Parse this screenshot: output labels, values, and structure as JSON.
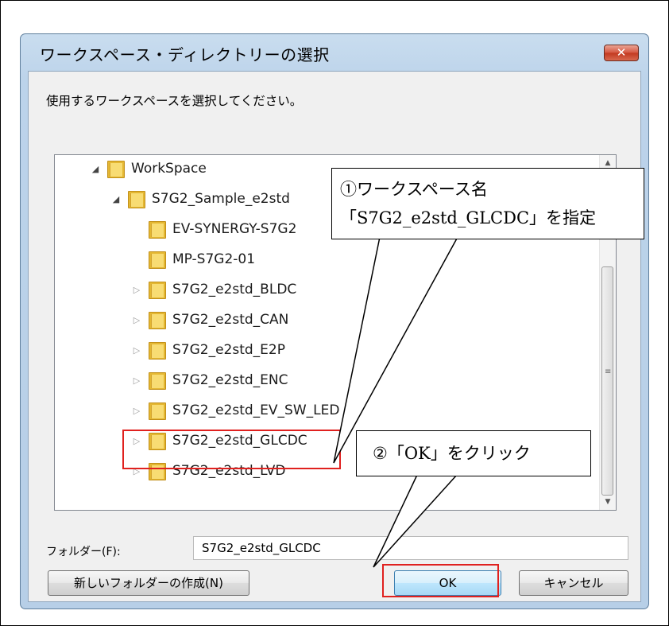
{
  "dialog": {
    "title": "ワークスペース・ディレクトリーの選択",
    "close_glyph": "✕",
    "instruction": "使用するワークスペースを選択してください。"
  },
  "tree": {
    "items": [
      {
        "label": "WorkSpace",
        "expander": "◢",
        "state": "expanded"
      },
      {
        "label": "S7G2_Sample_e2std",
        "expander": "◢",
        "state": "expanded"
      },
      {
        "label": "EV-SYNERGY-S7G2",
        "expander": "",
        "state": "leaf"
      },
      {
        "label": "MP-S7G2-01",
        "expander": "",
        "state": "leaf"
      },
      {
        "label": "S7G2_e2std_BLDC",
        "expander": "▷",
        "state": "collapsed"
      },
      {
        "label": "S7G2_e2std_CAN",
        "expander": "▷",
        "state": "collapsed"
      },
      {
        "label": "S7G2_e2std_E2P",
        "expander": "▷",
        "state": "collapsed"
      },
      {
        "label": "S7G2_e2std_ENC",
        "expander": "▷",
        "state": "collapsed"
      },
      {
        "label": "S7G2_e2std_EV_SW_LED",
        "expander": "▷",
        "state": "collapsed"
      },
      {
        "label": "S7G2_e2std_GLCDC",
        "expander": "▷",
        "state": "selected"
      },
      {
        "label": "S7G2_e2std_LVD",
        "expander": "▷",
        "state": "collapsed"
      }
    ],
    "scroll_up_glyph": "▲",
    "scroll_down_glyph": "▼",
    "scroll_grip_glyph": "≡"
  },
  "folder": {
    "label": "フォルダー(F):",
    "value": "S7G2_e2std_GLCDC"
  },
  "buttons": {
    "new_folder": "新しいフォルダーの作成(N)",
    "ok": "OK",
    "cancel": "キャンセル"
  },
  "callouts": {
    "step1_line1": "①ワークスペース名",
    "step1_line2": "「S7G2_e2std_GLCDC」を指定",
    "step2": "②「OK」をクリック"
  },
  "colors": {
    "highlight_red": "#e0211f",
    "dialog_frame": "#bcd3ea",
    "folder_yellow": "#f8dc73"
  }
}
